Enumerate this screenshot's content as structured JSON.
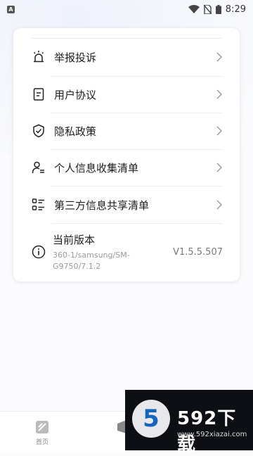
{
  "status_bar": {
    "time": "8:29",
    "app_badge": "A"
  },
  "menu": {
    "items": [
      {
        "label": "举报投诉",
        "icon": "alarm-icon"
      },
      {
        "label": "用户协议",
        "icon": "document-icon"
      },
      {
        "label": "隐私政策",
        "icon": "shield-icon"
      },
      {
        "label": "个人信息收集清单",
        "icon": "user-list-icon"
      },
      {
        "label": "第三方信息共享清单",
        "icon": "list-icon"
      }
    ]
  },
  "version": {
    "title": "当前版本",
    "detail": "360-1/samsung/SM-G9750/7.1.2",
    "number": "V1.5.5.507"
  },
  "bottom_nav": {
    "home_label": "首页"
  },
  "watermark": {
    "brand": "592下载",
    "url": "www.592xiazai.com",
    "logo_char": "5"
  },
  "colors": {
    "accent": "#1565c0",
    "text": "#1e1e1e",
    "muted": "#9a9a9a"
  }
}
